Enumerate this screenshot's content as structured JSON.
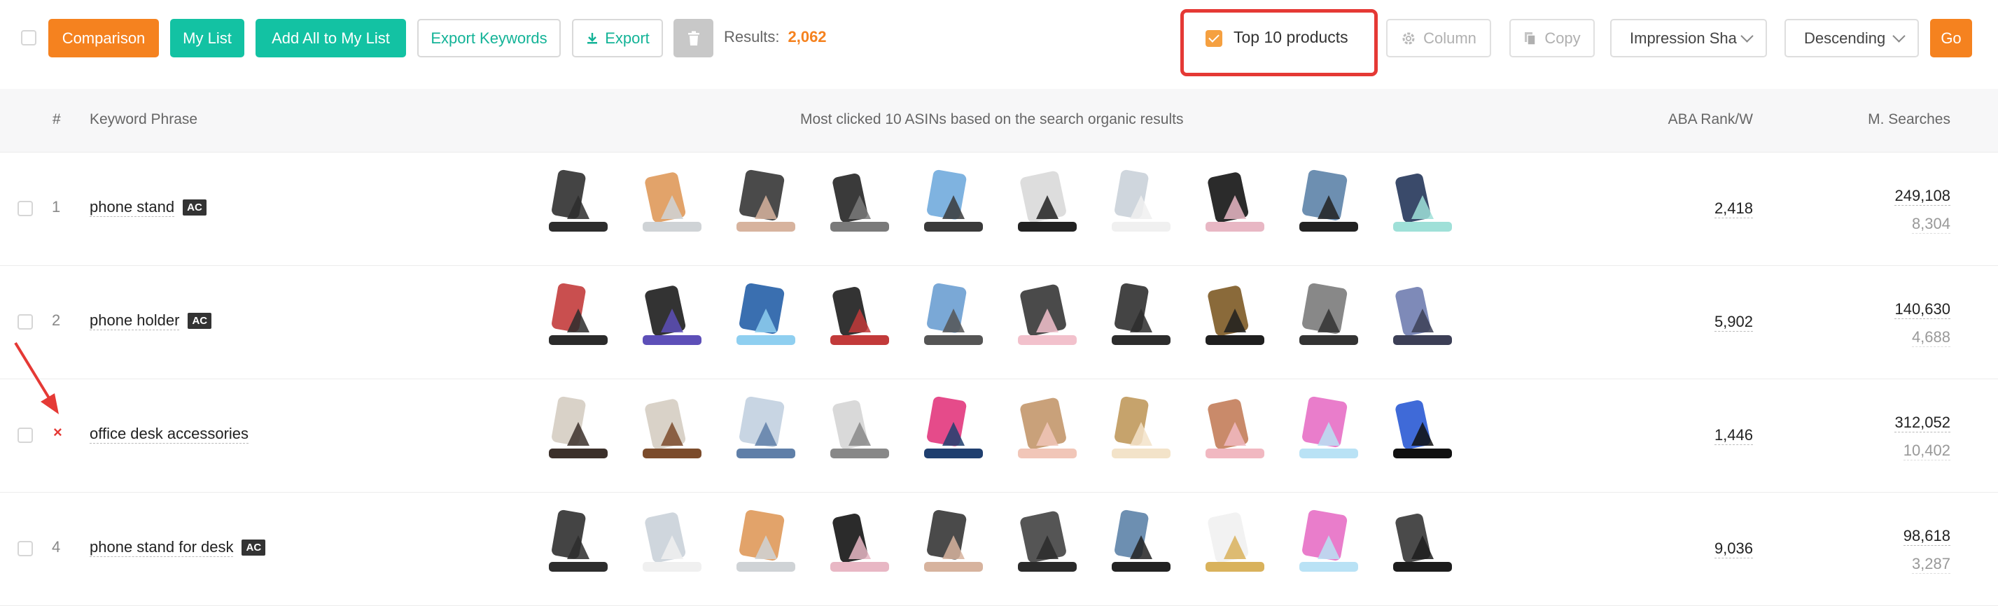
{
  "toolbar": {
    "comparison": "Comparison",
    "my_list": "My List",
    "add_all": "Add All to My List",
    "export_keywords": "Export Keywords",
    "export": "Export",
    "results_label": "Results:",
    "results_count": "2,062",
    "top10_label": "Top 10 products",
    "top10_checked": true,
    "column": "Column",
    "copy": "Copy",
    "sort_field": "Impression Sha",
    "sort_order": "Descending",
    "go": "Go"
  },
  "table": {
    "headers": {
      "index": "#",
      "keyword": "Keyword Phrase",
      "products": "Most clicked 10 ASINs based on the search organic results",
      "rank": "ABA Rank/W",
      "searches": "M. Searches"
    },
    "rows": [
      {
        "index": "1",
        "keyword": "phone stand",
        "badge": "AC",
        "rank": "2,418",
        "searches": "249,108",
        "searches_sub": "8,304",
        "products": [
          "stand-black",
          "stand-silver",
          "stand-rose",
          "mount-gray",
          "holder-blue",
          "lamp-arm",
          "stand-white",
          "stand-pink",
          "tablet-stand",
          "phone-cyan"
        ]
      },
      {
        "index": "2",
        "keyword": "phone holder",
        "badge": "AC",
        "rank": "5,902",
        "searches": "140,630",
        "searches_sub": "4,688",
        "products": [
          "car-mount",
          "vent-magnet",
          "clip-blue",
          "vent-red",
          "dash-mount",
          "phone-pink",
          "stand-black",
          "gooseneck",
          "clamp-black",
          "magnet-round"
        ]
      },
      {
        "index": "",
        "keyword": "office desk accessories",
        "badge": "",
        "rank": "1,446",
        "searches": "312,052",
        "searches_sub": "10,402",
        "products": [
          "caddy-dark",
          "caddy-brown",
          "wire-tray",
          "monitor-riser",
          "whiteboard",
          "paper-tray",
          "notes",
          "pink-organizer",
          "acrylic-stand",
          "seat-cushion"
        ]
      },
      {
        "index": "4",
        "keyword": "phone stand for desk",
        "badge": "AC",
        "rank": "9,036",
        "searches": "98,618",
        "searches_sub": "3,287",
        "products": [
          "stand-black",
          "stand-white",
          "stand-silver",
          "stand-pink",
          "stand-rose",
          "stand-dark",
          "tablet-stand",
          "stand-gold",
          "acrylic-stand",
          "stand-flat"
        ]
      }
    ],
    "annotation_mark": "×",
    "annotation_arrow_color": "#e53935"
  },
  "colors": {
    "orange": "#f5821f",
    "teal": "#13c2a3",
    "highlight_red": "#e53935"
  }
}
